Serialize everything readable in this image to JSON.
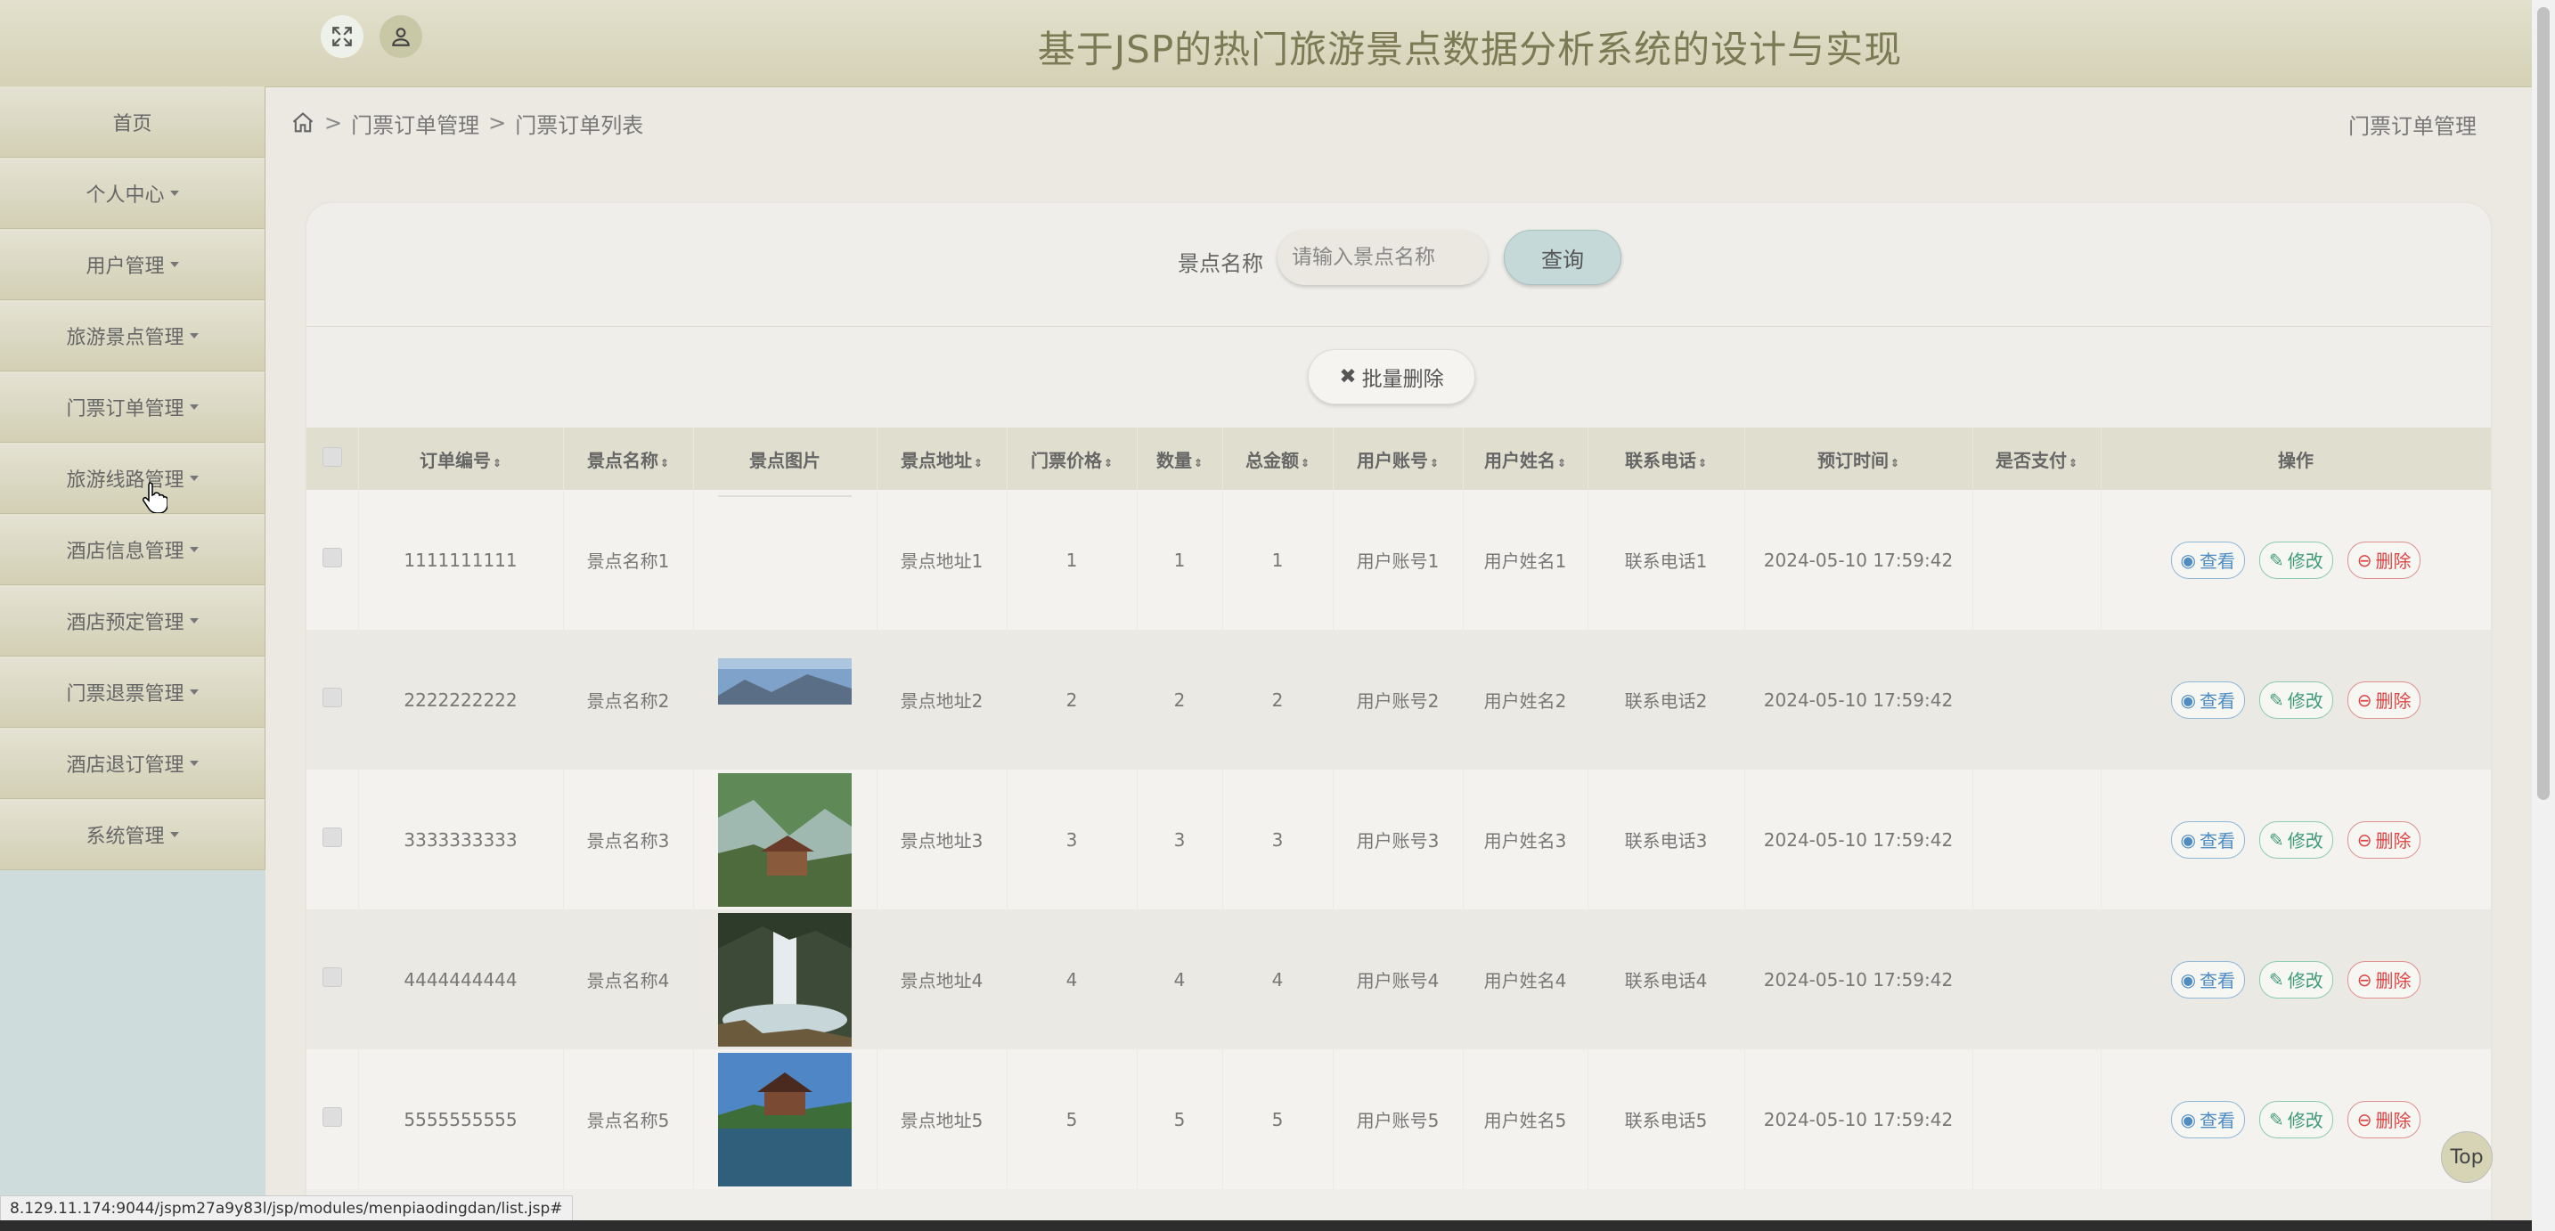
{
  "header": {
    "title": "基于JSP的热门旅游景点数据分析系统的设计与实现"
  },
  "sidebar": {
    "items": [
      {
        "label": "首页",
        "dropdown": false
      },
      {
        "label": "个人中心",
        "dropdown": true
      },
      {
        "label": "用户管理",
        "dropdown": true
      },
      {
        "label": "旅游景点管理",
        "dropdown": true
      },
      {
        "label": "门票订单管理",
        "dropdown": true
      },
      {
        "label": "旅游线路管理",
        "dropdown": true
      },
      {
        "label": "酒店信息管理",
        "dropdown": true
      },
      {
        "label": "酒店预定管理",
        "dropdown": true
      },
      {
        "label": "门票退票管理",
        "dropdown": true
      },
      {
        "label": "酒店退订管理",
        "dropdown": true
      },
      {
        "label": "系统管理",
        "dropdown": true
      }
    ]
  },
  "breadcrumb": {
    "sep": ">",
    "level1": "门票订单管理",
    "level2": "门票订单列表",
    "right": "门票订单管理"
  },
  "search": {
    "label": "景点名称",
    "placeholder": "请输入景点名称",
    "button": "查询"
  },
  "batch_delete": {
    "label": "批量删除"
  },
  "table": {
    "columns": [
      "订单编号",
      "景点名称",
      "景点图片",
      "景点地址",
      "门票价格",
      "数量",
      "总金额",
      "用户账号",
      "用户姓名",
      "联系电话",
      "预订时间",
      "是否支付",
      "操作"
    ],
    "actions": {
      "view": "查看",
      "edit": "修改",
      "delete": "删除"
    },
    "rows": [
      {
        "order_no": "1111111111",
        "spot_name": "景点名称1",
        "address": "景点地址1",
        "price": "1",
        "qty": "1",
        "total": "1",
        "account": "用户账号1",
        "user_name": "用户姓名1",
        "phone": "联系电话1",
        "time": "2024-05-10 17:59:42",
        "paid": "",
        "image": "broken"
      },
      {
        "order_no": "2222222222",
        "spot_name": "景点名称2",
        "address": "景点地址2",
        "price": "2",
        "qty": "2",
        "total": "2",
        "account": "用户账号2",
        "user_name": "用户姓名2",
        "phone": "联系电话2",
        "time": "2024-05-10 17:59:42",
        "paid": "",
        "image": "mountain-partial"
      },
      {
        "order_no": "3333333333",
        "spot_name": "景点名称3",
        "address": "景点地址3",
        "price": "3",
        "qty": "3",
        "total": "3",
        "account": "用户账号3",
        "user_name": "用户姓名3",
        "phone": "联系电话3",
        "time": "2024-05-10 17:59:42",
        "paid": "",
        "image": "temple-cliff"
      },
      {
        "order_no": "4444444444",
        "spot_name": "景点名称4",
        "address": "景点地址4",
        "price": "4",
        "qty": "4",
        "total": "4",
        "account": "用户账号4",
        "user_name": "用户姓名4",
        "phone": "联系电话4",
        "time": "2024-05-10 17:59:42",
        "paid": "",
        "image": "waterfall"
      },
      {
        "order_no": "5555555555",
        "spot_name": "景点名称5",
        "address": "景点地址5",
        "price": "5",
        "qty": "5",
        "total": "5",
        "account": "用户账号5",
        "user_name": "用户姓名5",
        "phone": "联系电话5",
        "time": "2024-05-10 17:59:42",
        "paid": "",
        "image": "pavilion-lake"
      }
    ]
  },
  "top_button": {
    "label": "Top"
  },
  "status_bar": {
    "url": "8.129.11.174:9044/jspm27a9y83l/jsp/modules/menpiaodingdan/list.jsp#"
  }
}
